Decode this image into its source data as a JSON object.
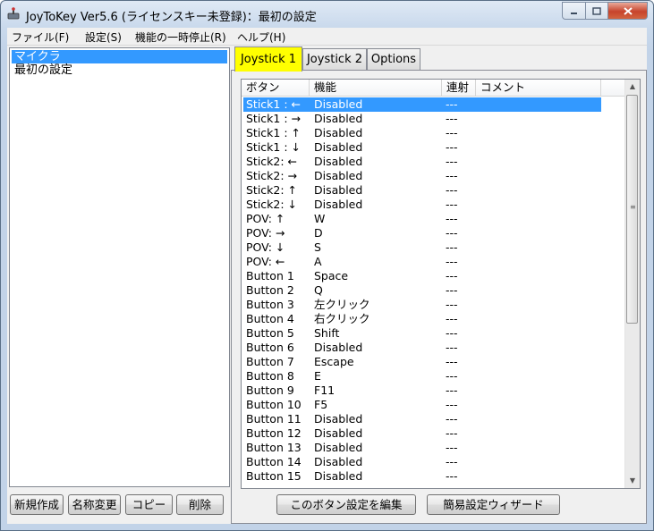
{
  "window": {
    "title": "JoyToKey Ver5.6 (ライセンスキー未登録)：最初の設定"
  },
  "menu": [
    {
      "label": "ファイル(F)"
    },
    {
      "label": "設定(S)"
    },
    {
      "label": "機能の一時停止(R)"
    },
    {
      "label": "ヘルプ(H)"
    }
  ],
  "profiles": [
    {
      "name": "マイクラ",
      "selected": true
    },
    {
      "name": "最初の設定",
      "selected": false
    }
  ],
  "profile_buttons": {
    "new": "新規作成",
    "rename": "名称変更",
    "copy": "コピー",
    "delete": "削除"
  },
  "tabs": [
    {
      "label": "Joystick 1",
      "active": true
    },
    {
      "label": "Joystick 2",
      "active": false
    },
    {
      "label": "Options",
      "active": false
    }
  ],
  "table": {
    "columns": [
      "ボタン",
      "機能",
      "連射",
      "コメント"
    ],
    "rows": [
      {
        "button": "Stick1 : ←",
        "function": "Disabled",
        "rapid": "---",
        "comment": "",
        "selected": true
      },
      {
        "button": "Stick1 : →",
        "function": "Disabled",
        "rapid": "---",
        "comment": ""
      },
      {
        "button": "Stick1 : ↑",
        "function": "Disabled",
        "rapid": "---",
        "comment": ""
      },
      {
        "button": "Stick1 : ↓",
        "function": "Disabled",
        "rapid": "---",
        "comment": ""
      },
      {
        "button": "Stick2: ←",
        "function": "Disabled",
        "rapid": "---",
        "comment": ""
      },
      {
        "button": "Stick2: →",
        "function": "Disabled",
        "rapid": "---",
        "comment": ""
      },
      {
        "button": "Stick2: ↑",
        "function": "Disabled",
        "rapid": "---",
        "comment": ""
      },
      {
        "button": "Stick2: ↓",
        "function": "Disabled",
        "rapid": "---",
        "comment": ""
      },
      {
        "button": "POV: ↑",
        "function": "W",
        "rapid": "---",
        "comment": ""
      },
      {
        "button": "POV: →",
        "function": "D",
        "rapid": "---",
        "comment": ""
      },
      {
        "button": "POV: ↓",
        "function": "S",
        "rapid": "---",
        "comment": ""
      },
      {
        "button": "POV: ←",
        "function": "A",
        "rapid": "---",
        "comment": ""
      },
      {
        "button": "Button 1",
        "function": "Space",
        "rapid": "---",
        "comment": ""
      },
      {
        "button": "Button 2",
        "function": "Q",
        "rapid": "---",
        "comment": ""
      },
      {
        "button": "Button 3",
        "function": "左クリック",
        "rapid": "---",
        "comment": ""
      },
      {
        "button": "Button 4",
        "function": "右クリック",
        "rapid": "---",
        "comment": ""
      },
      {
        "button": "Button 5",
        "function": "Shift",
        "rapid": "---",
        "comment": ""
      },
      {
        "button": "Button 6",
        "function": "Disabled",
        "rapid": "---",
        "comment": ""
      },
      {
        "button": "Button 7",
        "function": "Escape",
        "rapid": "---",
        "comment": ""
      },
      {
        "button": "Button 8",
        "function": "E",
        "rapid": "---",
        "comment": ""
      },
      {
        "button": "Button 9",
        "function": "F11",
        "rapid": "---",
        "comment": ""
      },
      {
        "button": "Button 10",
        "function": "F5",
        "rapid": "---",
        "comment": ""
      },
      {
        "button": "Button 11",
        "function": "Disabled",
        "rapid": "---",
        "comment": ""
      },
      {
        "button": "Button 12",
        "function": "Disabled",
        "rapid": "---",
        "comment": ""
      },
      {
        "button": "Button 13",
        "function": "Disabled",
        "rapid": "---",
        "comment": ""
      },
      {
        "button": "Button 14",
        "function": "Disabled",
        "rapid": "---",
        "comment": ""
      },
      {
        "button": "Button 15",
        "function": "Disabled",
        "rapid": "---",
        "comment": ""
      }
    ]
  },
  "action_buttons": {
    "edit": "このボタン設定を編集",
    "wizard": "簡易設定ウィザード"
  },
  "colors": {
    "selection": "#3399ff",
    "active_tab": "#ffff00"
  },
  "icons": {
    "app": "joystick-icon",
    "minimize": "minimize-icon",
    "maximize": "maximize-icon",
    "close": "close-icon"
  }
}
